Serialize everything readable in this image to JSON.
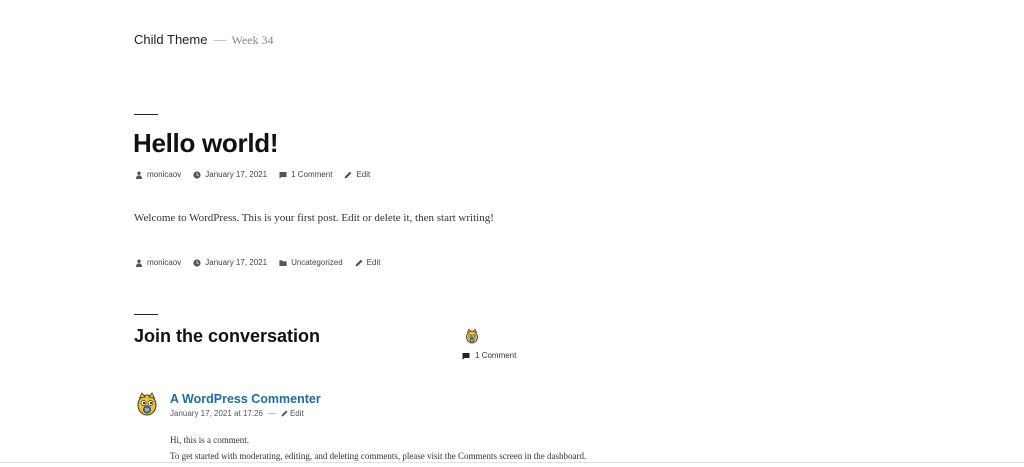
{
  "site": {
    "title": "Child Theme",
    "separator": "—",
    "description": "Week 34"
  },
  "post": {
    "title": "Hello world!",
    "meta_top": {
      "author": "monicaov",
      "date": "January 17, 2021",
      "comments": "1 Comment",
      "edit": "Edit"
    },
    "content": "Welcome to WordPress. This is your first post. Edit or delete it, then start writing!",
    "meta_bottom": {
      "author": "monicaov",
      "date": "January 17, 2021",
      "category": "Uncategorized",
      "edit": "Edit"
    }
  },
  "comments_section": {
    "title": "Join the conversation",
    "count": "1 Comment",
    "comments": [
      {
        "author": "A WordPress Commenter",
        "date": "January 17, 2021 at 17:26",
        "separator": "—",
        "edit": "Edit",
        "paragraphs": [
          "Hi, this is a comment.",
          "To get started with moderating, editing, and deleting comments, please visit the Comments screen in the dashboard."
        ]
      }
    ]
  },
  "colors": {
    "link_blue": "#1b6fa0",
    "text": "#111111",
    "muted": "#444444"
  },
  "icons": [
    "person-icon",
    "clock-icon",
    "comment-icon",
    "pencil-icon",
    "folder-icon",
    "wapuu-avatar"
  ]
}
